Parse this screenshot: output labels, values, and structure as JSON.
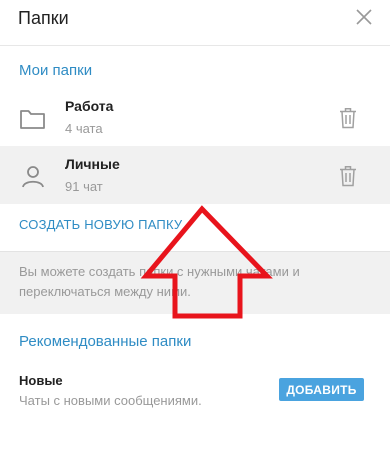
{
  "header": {
    "title": "Папки"
  },
  "my_folders": {
    "title": "Мои папки",
    "items": [
      {
        "name": "Работа",
        "count": "4 чата",
        "icon": "folder-icon"
      },
      {
        "name": "Личные",
        "count": "91 чат",
        "icon": "person-icon"
      }
    ]
  },
  "create_label": "СОЗДАТЬ НОВУЮ ПАПКУ",
  "info_text": "Вы можете создать папки с нужными чатами и переключаться между ними.",
  "recommended": {
    "title": "Рекомендованные папки",
    "items": [
      {
        "name": "Новые",
        "description": "Чаты с новыми сообщениями.",
        "button": "ДОБАВИТЬ"
      }
    ]
  },
  "colors": {
    "accent": "#2f8cc4",
    "button": "#4aa3df",
    "arrow": "#e8141c"
  }
}
